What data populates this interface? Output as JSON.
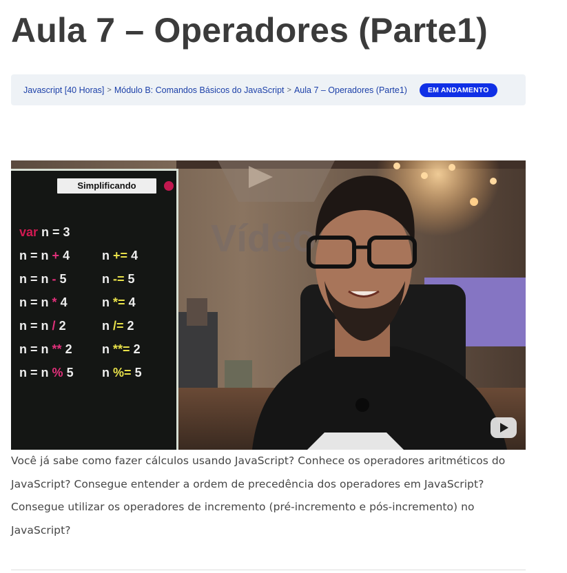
{
  "page": {
    "title": "Aula 7 – Operadores (Parte1)"
  },
  "breadcrumb": {
    "items": [
      "Javascript [40 Horas]",
      "Módulo B: Comandos Básicos do JavaScript",
      "Aula 7 – Operadores (Parte1)"
    ],
    "separator": ">",
    "status_badge": "EM ANDAMENTO"
  },
  "video": {
    "panel_label": "Simplificando",
    "wall_sign_text": "Vídeo",
    "code_lines": {
      "declaration": {
        "keyword": "var",
        "rest": "n = 3"
      },
      "left": [
        {
          "pre": "n = n",
          "op": "+",
          "val": "4"
        },
        {
          "pre": "n = n",
          "op": "-",
          "val": "5"
        },
        {
          "pre": "n = n",
          "op": "*",
          "val": "4"
        },
        {
          "pre": "n = n",
          "op": "/",
          "val": "2"
        },
        {
          "pre": "n = n",
          "op": "**",
          "val": "2"
        },
        {
          "pre": "n = n",
          "op": "%",
          "val": "5"
        }
      ],
      "right": [
        {
          "pre": "n",
          "op": "+=",
          "val": "4"
        },
        {
          "pre": "n",
          "op": "-=",
          "val": "5"
        },
        {
          "pre": "n",
          "op": "*=",
          "val": "4"
        },
        {
          "pre": "n",
          "op": "/=",
          "val": "2"
        },
        {
          "pre": "n",
          "op": "**=",
          "val": "2"
        },
        {
          "pre": "n",
          "op": "%=",
          "val": "5"
        }
      ]
    },
    "play_icon": "youtube-play-icon"
  },
  "description": "Você já sabe como fazer cálculos usando JavaScript? Conhece os operadores aritméticos do JavaScript? Consegue entender a ordem de precedência dos operadores em JavaScript? Consegue utilizar os operadores de incremento (pré-incremento e pós-incremento) no JavaScript?",
  "colors": {
    "badge": "#1030e6",
    "breadcrumb_link": "#1b3fa8",
    "breadcrumb_bg": "#eef2f6",
    "code_keyword": "#d11a52",
    "code_assign_op": "#e9e24a"
  }
}
